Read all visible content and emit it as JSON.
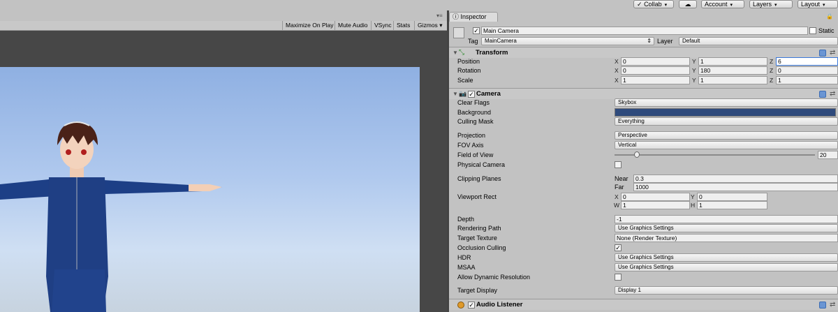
{
  "toolbar": {
    "collab": "Collab",
    "account": "Account",
    "layers": "Layers",
    "layout": "Layout"
  },
  "game": {
    "maximize": "Maximize On Play",
    "mute": "Mute Audio",
    "vsync": "VSync",
    "stats": "Stats",
    "gizmos": "Gizmos"
  },
  "inspector": {
    "tab": "Inspector",
    "object_name": "Main Camera",
    "static_label": "Static",
    "tag_label": "Tag",
    "tag_value": "MainCamera",
    "layer_label": "Layer",
    "layer_value": "Default",
    "transform": {
      "title": "Transform",
      "position_label": "Position",
      "rotation_label": "Rotation",
      "scale_label": "Scale",
      "position": {
        "x": "0",
        "y": "1",
        "z": "6"
      },
      "rotation": {
        "x": "0",
        "y": "180",
        "z": "0"
      },
      "scale": {
        "x": "1",
        "y": "1",
        "z": "1"
      }
    },
    "camera": {
      "title": "Camera",
      "clear_flags_label": "Clear Flags",
      "clear_flags": "Skybox",
      "background_label": "Background",
      "background_color": "#2e4a7c",
      "culling_mask_label": "Culling Mask",
      "culling_mask": "Everything",
      "projection_label": "Projection",
      "projection": "Perspective",
      "fov_axis_label": "FOV Axis",
      "fov_axis": "Vertical",
      "fov_label": "Field of View",
      "fov": "20",
      "fov_fraction": 0.11,
      "physical_label": "Physical Camera",
      "clipping_label": "Clipping Planes",
      "near_label": "Near",
      "near": "0.3",
      "far_label": "Far",
      "far": "1000",
      "viewport_label": "Viewport Rect",
      "viewport": {
        "x": "0",
        "y": "0",
        "w": "1",
        "h": "1"
      },
      "depth_label": "Depth",
      "depth": "-1",
      "rendering_path_label": "Rendering Path",
      "rendering_path": "Use Graphics Settings",
      "target_texture_label": "Target Texture",
      "target_texture": "None (Render Texture)",
      "occlusion_label": "Occlusion Culling",
      "hdr_label": "HDR",
      "hdr": "Use Graphics Settings",
      "msaa_label": "MSAA",
      "msaa": "Use Graphics Settings",
      "dynres_label": "Allow Dynamic Resolution",
      "target_display_label": "Target Display",
      "target_display": "Display 1"
    },
    "audio_listener_title": "Audio Listener"
  }
}
